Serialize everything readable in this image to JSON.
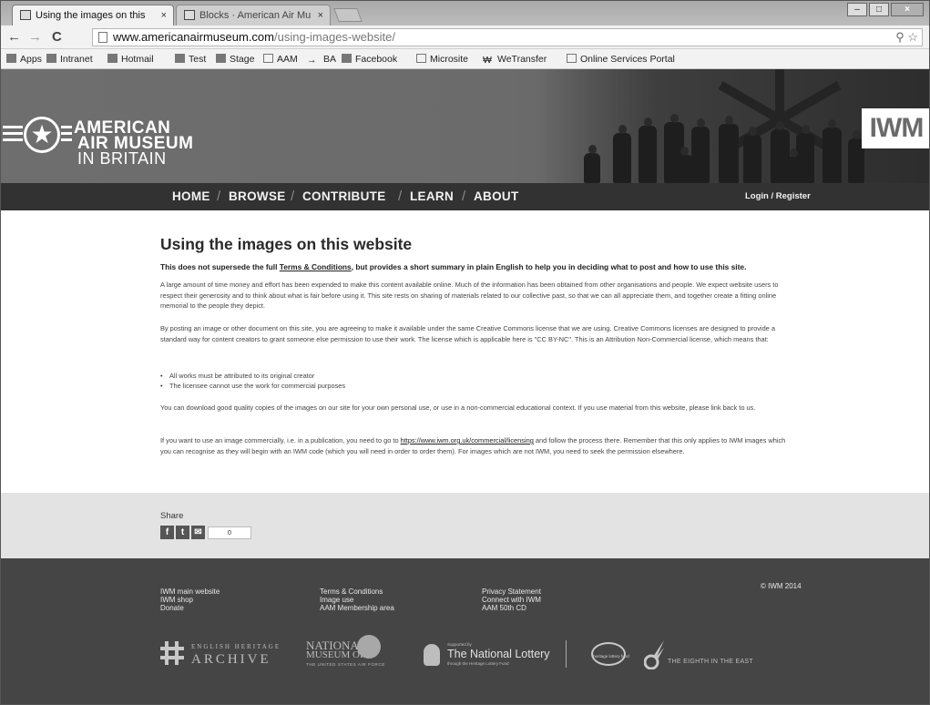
{
  "browser": {
    "tabs": [
      {
        "label": "Using the images on this",
        "close": "×",
        "active": true
      },
      {
        "label": "Blocks · American Air Mu",
        "close": "×",
        "active": false
      }
    ],
    "window_buttons": [
      "–",
      "□",
      "×"
    ],
    "nav": {
      "back": "←",
      "forward": "→",
      "reload": "C"
    },
    "address": {
      "host": "www.americanairmuseum.com",
      "path": "/using-images-website/",
      "zoom_icon": "⚲",
      "star_icon": "☆"
    },
    "bookmarks": [
      {
        "label": "Apps",
        "icon": "apps-icon"
      },
      {
        "label": "Intranet",
        "icon": "intranet-icon"
      },
      {
        "label": "Hotmail",
        "icon": "hotmail-icon"
      },
      {
        "label": "Test",
        "icon": "test-icon"
      },
      {
        "label": "Stage",
        "icon": "stage-icon"
      },
      {
        "label": "AAM",
        "icon": "folder-icon"
      },
      {
        "label": "BA",
        "icon": "ba-icon"
      },
      {
        "label": "Facebook",
        "icon": "facebook-icon"
      },
      {
        "label": "Microsite",
        "icon": "folder-icon"
      },
      {
        "label": "WeTransfer",
        "icon": "wetransfer-icon"
      },
      {
        "label": "Online Services Portal",
        "icon": "folder-icon"
      }
    ]
  },
  "site": {
    "logo": {
      "line1": "AMERICAN",
      "line2": "AIR MUSEUM",
      "line3": "IN BRITAIN",
      "star": "★"
    },
    "badge": "IWM",
    "nav": [
      {
        "label": "HOME"
      },
      {
        "label": "BROWSE"
      },
      {
        "label": "CONTRIBUTE"
      },
      {
        "label": "LEARN"
      },
      {
        "label": "ABOUT"
      }
    ],
    "nav_separator": "/",
    "login": "Login / Register",
    "article": {
      "title": "Using the images on this website",
      "lead_before": "This does not supersede the full ",
      "lead_link": "Terms & Conditions",
      "lead_after": ", but provides a short summary in plain English to help you in deciding what to post and how to use this site.",
      "p2": "A large amount of time money and effort has been expended to make this content available online. Much of the information has been obtained from other organisations and people. We expect website users to respect their generosity and to think about what is fair before using it. This site rests on sharing of materials related to our collective past, so that we can all appreciate them, and together create a fitting online memorial to the people they depict.",
      "p3": "By posting an image or other document on this site, you are agreeing to make it available under the same Creative Commons license that we are using. Creative Commons licenses are designed to provide a standard way for content creators to grant someone else permission to use their work. The license which is applicable here is \"CC BY-NC\". This is an Attribution Non-Commercial license, which means that:",
      "bullets": [
        "All works must be attributed to its original creator",
        "The licensee cannot use the work for commercial purposes"
      ],
      "p4": "You can download good quality copies of the images on our site for your own personal use, or use in a non-commercial educational context. If you use material from this website, please link back to us.",
      "p5_before": "If you want to use an image commercially, i.e. in a publication, you need to go to ",
      "p5_link": "https://www.iwm.org.uk/commercial/licensing",
      "p5_after": " and follow the process there. Remember that this only applies to IWM images which you can recognise as they will begin with an IWM code (which you will need in order to order them). For images which are not IWM, you need to seek the permission elsewhere."
    },
    "share": {
      "label": "Share",
      "buttons": [
        "f",
        "t",
        "✉"
      ],
      "count": "0"
    },
    "footer": {
      "col1": [
        "IWM main website",
        "IWM shop",
        "Donate"
      ],
      "col2": [
        "Terms & Conditions",
        "Image use",
        "AAM Membership area"
      ],
      "col3": [
        "Privacy Statement",
        "Connect with IWM",
        "AAM 50th CD"
      ],
      "copyright": "© IWM 2014",
      "partners": {
        "heritage": {
          "line1": "ENGLISH HERITAGE",
          "line2": "ARCHIVE"
        },
        "nmusaf": {
          "line1": "NATIONAL",
          "line2": "MUSEUM OF",
          "line3": "THE UNITED STATES AIR FORCE"
        },
        "lottery": {
          "top": "Supported by",
          "name": "The National Lottery",
          "bottom": "through the Heritage Lottery Fund"
        },
        "hlf": {
          "text": "heritage lottery fund"
        },
        "eighth": {
          "text": "THE EIGHTH IN THE EAST"
        }
      }
    }
  }
}
